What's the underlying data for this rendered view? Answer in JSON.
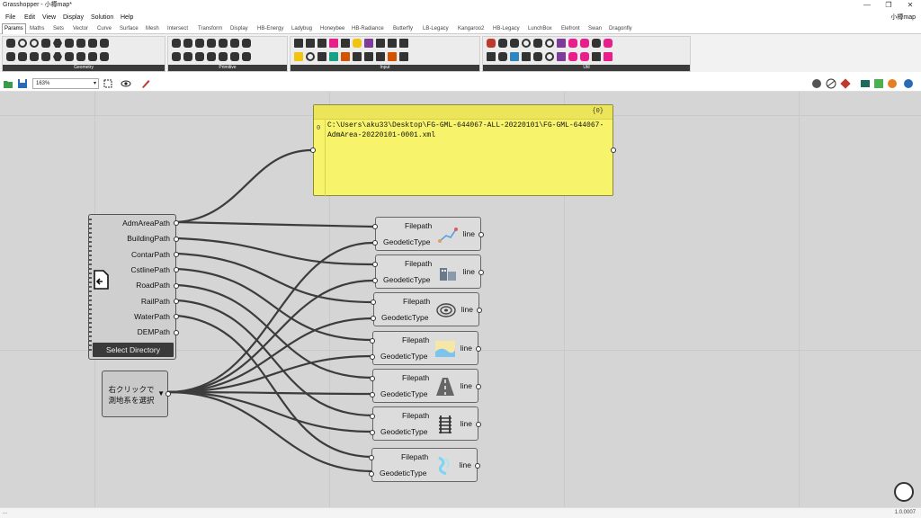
{
  "window": {
    "title": "Grasshopper - 小樽map*",
    "controls": [
      "—",
      "❐",
      "✕"
    ]
  },
  "menu": {
    "items": [
      "File",
      "Edit",
      "View",
      "Display",
      "Solution",
      "Help"
    ],
    "doc_name": "小樽map"
  },
  "tabs": [
    "Params",
    "Maths",
    "Sets",
    "Vector",
    "Curve",
    "Surface",
    "Mesh",
    "Intersect",
    "Transform",
    "Display",
    "HB-Energy",
    "Ladybug",
    "Honeybee",
    "HB-Radiance",
    "Butterfly",
    "LB-Legacy",
    "Kangaroo2",
    "HB-Legacy",
    "LunchBox",
    "Elefront",
    "Swan",
    "Dragonfly"
  ],
  "active_tab": "Params",
  "ribbon_groups": [
    "Geometry",
    "Primitive",
    "Input",
    "Util"
  ],
  "toolbar": {
    "zoom": "163%"
  },
  "panel": {
    "count": "{0}",
    "index": "0",
    "text": "C:\\Users\\aku33\\Desktop\\FG-GML-644067-ALL-20220101\\FG-GML-644067-AdmArea-20220101-0001.xml"
  },
  "path_component": {
    "outputs": [
      "AdmAreaPath",
      "BuildingPath",
      "ContarPath",
      "CstlinePath",
      "RoadPath",
      "RailPath",
      "WaterPath",
      "DEMPath"
    ],
    "button": "Select Directory"
  },
  "value_list": {
    "line1": "右クリックで",
    "line2": "測地系を選択"
  },
  "line_components": [
    {
      "in1": "Filepath",
      "in2": "GeodeticType",
      "out": "line",
      "icon": "admin-area-icon"
    },
    {
      "in1": "Filepath",
      "in2": "GeodeticType",
      "out": "line",
      "icon": "building-icon"
    },
    {
      "in1": "Filepath",
      "in2": "GeodeticType",
      "out": "line",
      "icon": "contour-icon"
    },
    {
      "in1": "Filepath",
      "in2": "GeodeticType",
      "out": "line",
      "icon": "coastline-icon"
    },
    {
      "in1": "Filepath",
      "in2": "GeodeticType",
      "out": "line",
      "icon": "road-icon"
    },
    {
      "in1": "Filepath",
      "in2": "GeodeticType",
      "out": "line",
      "icon": "railway-icon"
    },
    {
      "in1": "Filepath",
      "in2": "GeodeticType",
      "out": "line",
      "icon": "water-icon"
    }
  ],
  "status": {
    "left": "...",
    "version": "1.0.0007"
  }
}
